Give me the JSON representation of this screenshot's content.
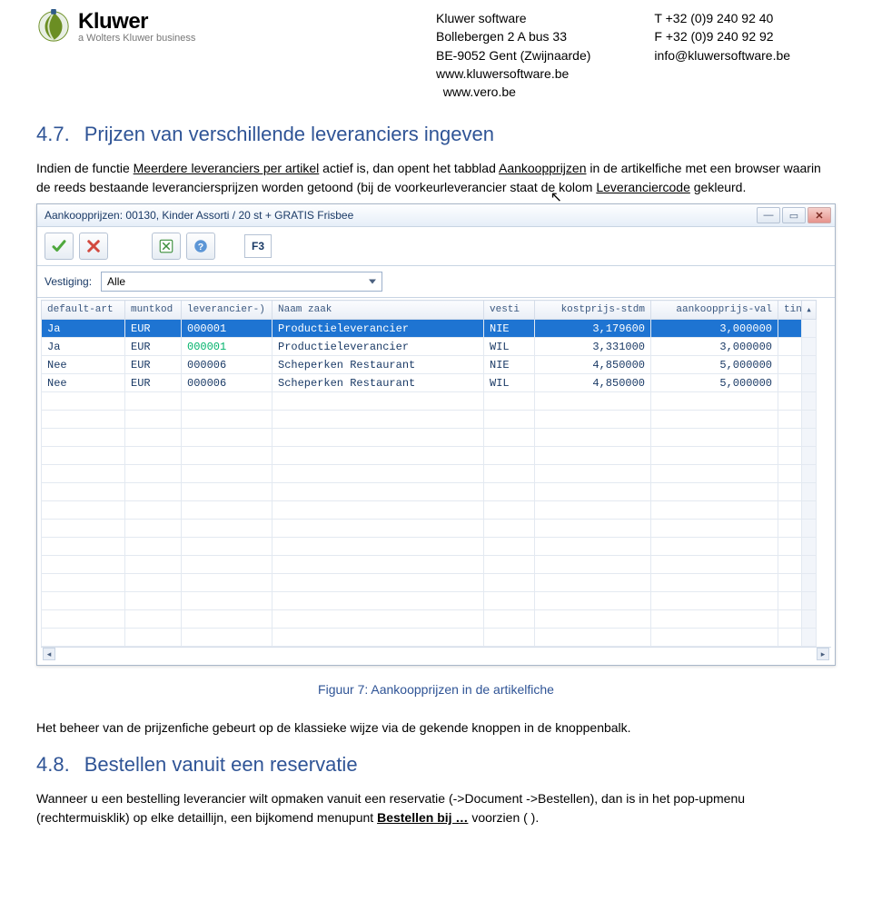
{
  "header": {
    "brand": "Kluwer",
    "tagline": "a Wolters Kluwer business",
    "address": "Kluwer software\nBollebergen 2 A bus 33\nBE-9052 Gent (Zwijnaarde)\nwww.kluwersoftware.be\n  www.vero.be",
    "contact": "T +32 (0)9 240 92 40\nF +32 (0)9 240 92 92\ninfo@kluwersoftware.be"
  },
  "sec47": {
    "num": "4.7.",
    "title": "Prijzen van verschillende leveranciers ingeven",
    "p1a": "Indien de functie ",
    "p1_link1": "Meerdere leveranciers per artikel",
    "p1b": " actief is, dan opent het tabblad ",
    "p1_link2": "Aankoopprijzen",
    "p1c": " in de artikelfiche met een browser waarin de reeds bestaande leveranciersprijzen worden getoond (bij de voorkeurleverancier staat de kolom ",
    "p1_link3": "Leveranciercode",
    "p1d": " gekleurd."
  },
  "win": {
    "title": "Aankoopprijzen: 00130, Kinder Assorti / 20 st + GRATIS Frisbee",
    "f3": "F3",
    "filter_label": "Vestiging:",
    "filter_value": "Alle",
    "columns": {
      "c1": "default-art",
      "c2": "muntkod",
      "c3": "leverancier-)",
      "c4": "Naam zaak",
      "c5": "vesti",
      "c6": "kostprijs-stdm",
      "c7": "aankoopprijs-val",
      "c8": "tin"
    },
    "rows": [
      {
        "def": "Ja",
        "munt": "EUR",
        "lev": "000001",
        "naam": "Productieleverancier",
        "vest": "NIE",
        "kost": "3,179600",
        "aank": "3,000000",
        "sel": true,
        "hl": false
      },
      {
        "def": "Ja",
        "munt": "EUR",
        "lev": "000001",
        "naam": "Productieleverancier",
        "vest": "WIL",
        "kost": "3,331000",
        "aank": "3,000000",
        "sel": false,
        "hl": true
      },
      {
        "def": "Nee",
        "munt": "EUR",
        "lev": "000006",
        "naam": "Scheperken Restaurant",
        "vest": "NIE",
        "kost": "4,850000",
        "aank": "5,000000",
        "sel": false,
        "hl": false
      },
      {
        "def": "Nee",
        "munt": "EUR",
        "lev": "000006",
        "naam": "Scheperken Restaurant",
        "vest": "WIL",
        "kost": "4,850000",
        "aank": "5,000000",
        "sel": false,
        "hl": false
      }
    ],
    "empty_rows": 14
  },
  "figcap": "Figuur 7: Aankoopprijzen in de artikelfiche",
  "p_after": "Het beheer van de prijzenfiche gebeurt op de klassieke wijze via de gekende knoppen in de knoppenbalk.",
  "sec48": {
    "num": "4.8.",
    "title": "Bestellen vanuit een reservatie",
    "p1a": "Wanneer u een bestelling leverancier wilt opmaken vanuit een reservatie (->Document ->Bestellen), dan is in het pop-upmenu (rechtermuisklik) op elke detaillijn, een bijkomend menupunt ",
    "p1_link": "Bestellen bij …",
    "p1b": " voorzien ( )."
  }
}
